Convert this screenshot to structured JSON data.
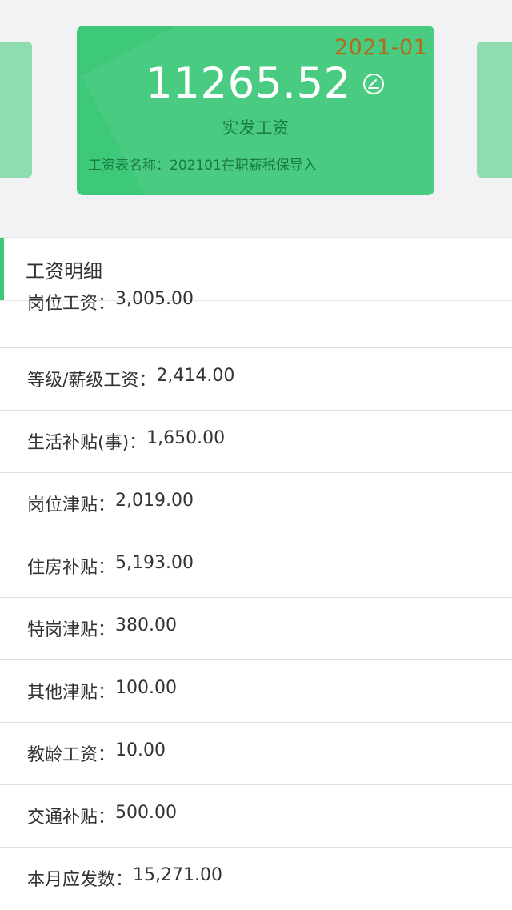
{
  "card": {
    "period": "2021-01",
    "amount": "11265.52",
    "amount_label": "实发工资",
    "sheet_name_label": "工资表名称：",
    "sheet_name_value": "202101在职薪税保导入",
    "edit_icon": "edit-pencil-circle-icon"
  },
  "section": {
    "title": "工资明细"
  },
  "items": [
    {
      "label": "岗位工资：",
      "value": "3,005.00"
    },
    {
      "label": "等级/薪级工资：",
      "value": "2,414.00"
    },
    {
      "label": "生活补贴(事)：",
      "value": "1,650.00"
    },
    {
      "label": "岗位津贴：",
      "value": "2,019.00"
    },
    {
      "label": "住房补贴：",
      "value": "5,193.00"
    },
    {
      "label": "特岗津贴：",
      "value": "380.00"
    },
    {
      "label": "其他津贴：",
      "value": "100.00"
    },
    {
      "label": "教龄工资：",
      "value": "10.00"
    },
    {
      "label": "交通补贴：",
      "value": "500.00"
    },
    {
      "label": "本月应发数：",
      "value": "15,271.00"
    }
  ],
  "colors": {
    "accent": "#3ec97a",
    "period": "#b36a1a",
    "side_card": "#8fdcb0"
  }
}
